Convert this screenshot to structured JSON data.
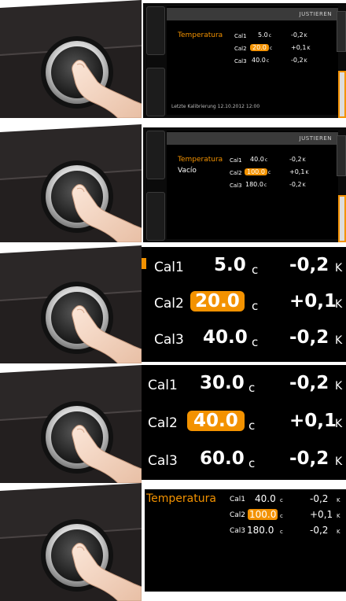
{
  "rows": [
    {
      "screen": {
        "header": "JUSTIEREN",
        "label": "Temperatura",
        "lines": [
          {
            "cal": "Cal1",
            "value": "5.0",
            "unit": "c",
            "delta": "-0,2",
            "k": "K"
          },
          {
            "cal": "Cal2",
            "value": "20.0",
            "unit": "c",
            "delta": "+0,1",
            "k": "K",
            "selected": true
          },
          {
            "cal": "Cal3",
            "value": "40.0",
            "unit": "c",
            "delta": "-0,2",
            "k": "K"
          }
        ],
        "footer": "Letzte Kalibrierung 12.10.2012  12:00"
      }
    },
    {
      "screen": {
        "header": "JUSTIEREN",
        "label": "Temperatura",
        "label2": "Vacío",
        "lines": [
          {
            "cal": "Cal1",
            "value": "40.0",
            "unit": "c",
            "delta": "-0,2",
            "k": "K"
          },
          {
            "cal": "Cal2",
            "value": "100.0",
            "unit": "c",
            "delta": "+0,1",
            "k": "K",
            "selected": true
          },
          {
            "cal": "Cal3",
            "value": "180.0",
            "unit": "c",
            "delta": "-0,2",
            "k": "K"
          }
        ]
      }
    },
    {
      "zoom": {
        "lines": [
          {
            "cal": "Cal1",
            "value": "5.0",
            "unit": "c",
            "delta": "-0,2",
            "k": "K"
          },
          {
            "cal": "Cal2",
            "value": "20.0",
            "unit": "c",
            "delta": "+0,1",
            "k": "K",
            "selected": true
          },
          {
            "cal": "Cal3",
            "value": "40.0",
            "unit": "c",
            "delta": "-0,2",
            "k": "K"
          }
        ]
      }
    },
    {
      "zoom": {
        "lines": [
          {
            "cal": "Cal1",
            "value": "30.0",
            "unit": "c",
            "delta": "-0,2",
            "k": "K"
          },
          {
            "cal": "Cal2",
            "value": "40.0",
            "unit": "c",
            "delta": "+0,1",
            "k": "K",
            "selected": true
          },
          {
            "cal": "Cal3",
            "value": "60.0",
            "unit": "c",
            "delta": "-0,2",
            "k": "K"
          }
        ]
      }
    },
    {
      "panel": {
        "label": "Temperatura",
        "lines": [
          {
            "cal": "Cal1",
            "value": "40.0",
            "unit": "c",
            "delta": "-0,2",
            "k": "K"
          },
          {
            "cal": "Cal2",
            "value": "100.0",
            "unit": "c",
            "delta": "+0,1",
            "k": "K",
            "selected": true
          },
          {
            "cal": "Cal3",
            "value": "180.0",
            "unit": "c",
            "delta": "-0,2",
            "k": "K"
          }
        ]
      }
    }
  ],
  "colors": {
    "accent": "#f39200",
    "screen": "#000000",
    "device": "#2b2727"
  }
}
